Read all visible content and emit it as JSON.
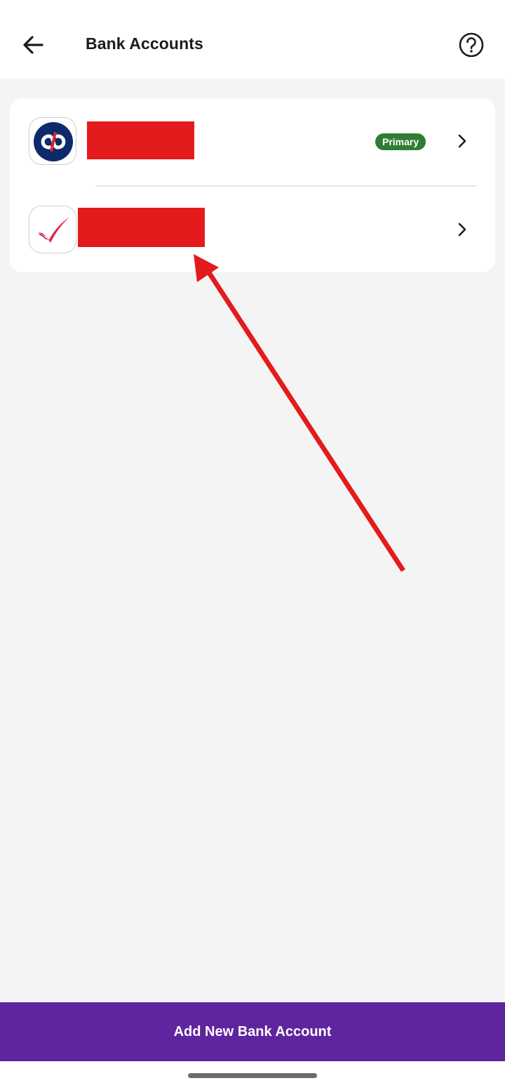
{
  "header": {
    "title": "Bank Accounts",
    "back_icon": "arrow-left-icon",
    "help_icon": "question-circle-icon"
  },
  "accounts": [
    {
      "logo_icon": "kotak-bank-logo",
      "name_redacted": true,
      "badge": "Primary",
      "chevron_icon": "chevron-right-icon"
    },
    {
      "logo_icon": "axis-checkmark-bank-logo",
      "name_redacted": true,
      "chevron_icon": "chevron-right-icon"
    }
  ],
  "annotation": {
    "type": "red-arrow",
    "points_to": "second-account-name"
  },
  "footer": {
    "add_button_label": "Add New Bank Account"
  },
  "colors": {
    "accent": "#5f259f",
    "primary_badge": "#2f7d35",
    "redaction": "#e41b1c",
    "background": "#f4f4f4"
  }
}
